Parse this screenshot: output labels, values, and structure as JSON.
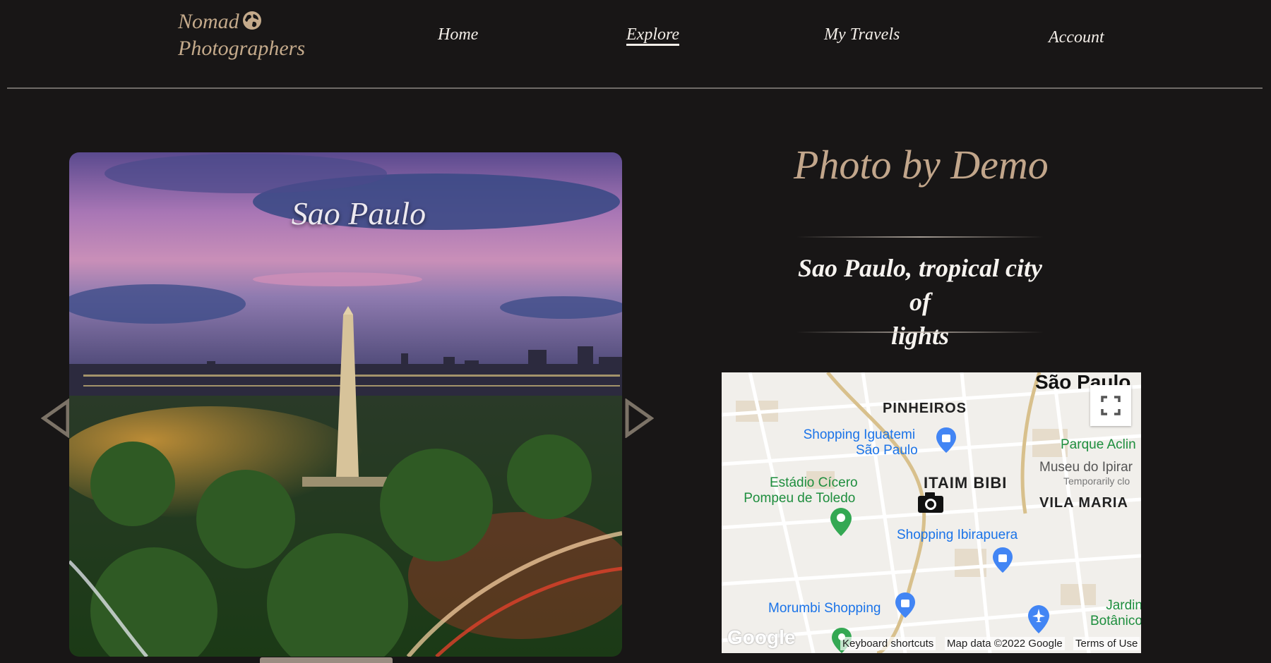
{
  "header": {
    "logo_line1": "Nomad",
    "logo_line2": "Photographers",
    "nav": [
      {
        "label": "Home"
      },
      {
        "label": "Explore"
      },
      {
        "label": "My Travels"
      },
      {
        "label": "Account"
      }
    ]
  },
  "slider": {
    "title": "Sao Paulo"
  },
  "details": {
    "photo_by": "Photo by Demo",
    "description_line1": "Sao Paulo, tropical city of",
    "description_line2": "lights"
  },
  "map": {
    "labels": {
      "city": "São Paulo",
      "pinheiros": "PINHEIROS",
      "iguatemi_line1": "Shopping Iguatemi",
      "iguatemi_line2": "São Paulo",
      "parque": "Parque Aclin",
      "museu": "Museu do Ipirar",
      "temporarily": "Temporarily clo",
      "estadio_line1": "Estádio Cícero",
      "estadio_line2": "Pompeu de Toledo",
      "itaim": "ITAIM BIBI",
      "vila_maria": "VILA MARIA",
      "ibirapuera": "Shopping Ibirapuera",
      "morumbi": "Morumbi Shopping",
      "jardim_line1": "Jardin",
      "jardim_line2": "Botânico",
      "google": "Google"
    },
    "attribution": {
      "shortcuts": "Keyboard shortcuts",
      "map_data": "Map data ©2022 Google",
      "terms": "Terms of Use"
    },
    "colors": {
      "poi_blue": "#4285f4",
      "park_green": "#34a853",
      "text_blue": "#1a73e8",
      "text_green": "#1e8e3e"
    }
  }
}
